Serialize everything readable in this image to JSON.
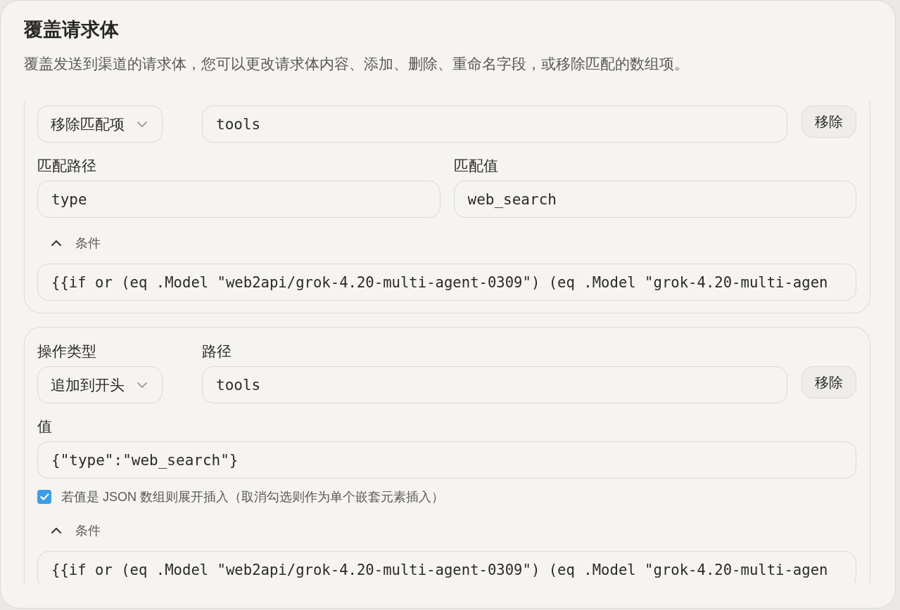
{
  "title": "覆盖请求体",
  "description": "覆盖发送到渠道的请求体，您可以更改请求体内容、添加、删除、重命名字段，或移除匹配的数组项。",
  "rules": [
    {
      "operation": {
        "value": "移除匹配项"
      },
      "path": {
        "value": "tools"
      },
      "remove_button": "移除",
      "fields": [
        {
          "label": "匹配路径",
          "value": "type"
        },
        {
          "label": "匹配值",
          "value": "web_search"
        }
      ],
      "condition": {
        "label": "条件",
        "expanded": true,
        "value": "{{if or (eq .Model \"web2api/grok-4.20-multi-agent-0309\") (eq .Model \"grok-4.20-multi-agen"
      }
    },
    {
      "operation_label": "操作类型",
      "operation": {
        "value": "追加到开头"
      },
      "path_label": "路径",
      "path": {
        "value": "tools"
      },
      "remove_button": "移除",
      "value_field": {
        "label": "值",
        "value": "{\"type\":\"web_search\"}"
      },
      "checkbox": {
        "label": "若值是 JSON 数组则展开插入（取消勾选则作为单个嵌套元素插入）",
        "checked": true
      },
      "condition": {
        "label": "条件",
        "expanded": true,
        "value": "{{if or (eq .Model \"web2api/grok-4.20-multi-agent-0309\") (eq .Model \"grok-4.20-multi-agen"
      }
    }
  ]
}
